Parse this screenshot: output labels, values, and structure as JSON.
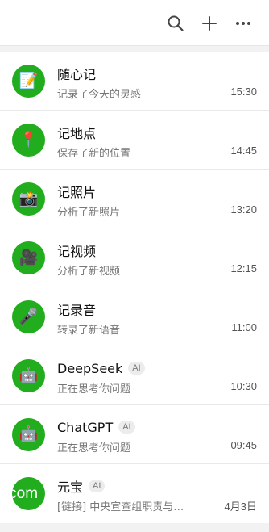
{
  "header": {
    "icons": [
      "search-icon",
      "plus-icon",
      "more-icon"
    ]
  },
  "chats": [
    {
      "name": "随心记",
      "preview": "记录了今天的灵感",
      "time": "15:30",
      "avatar_icon": "memo-icon",
      "avatar_glyph": "📝",
      "ai": false
    },
    {
      "name": "记地点",
      "preview": "保存了新的位置",
      "time": "14:45",
      "avatar_icon": "pin-icon",
      "avatar_glyph": "📍",
      "ai": false
    },
    {
      "name": "记照片",
      "preview": "分析了新照片",
      "time": "13:20",
      "avatar_icon": "camera-flash-icon",
      "avatar_glyph": "📸",
      "ai": false
    },
    {
      "name": "记视频",
      "preview": "分析了新视频",
      "time": "12:15",
      "avatar_icon": "video-camera-icon",
      "avatar_glyph": "🎥",
      "ai": false
    },
    {
      "name": "记录音",
      "preview": "转录了新语音",
      "time": "11:00",
      "avatar_icon": "microphone-icon",
      "avatar_glyph": "🎤",
      "ai": false
    },
    {
      "name": "DeepSeek",
      "preview": "正在思考你问题",
      "time": "10:30",
      "avatar_icon": "robot-icon",
      "avatar_glyph": "🤖",
      "ai": true,
      "badge": "AI"
    },
    {
      "name": "ChatGPT",
      "preview": "正在思考你问题",
      "time": "09:45",
      "avatar_icon": "robot-icon",
      "avatar_glyph": "🤖",
      "ai": true,
      "badge": "AI"
    },
    {
      "name": "元宝",
      "preview": "[链接] 中央宣查组职责与…",
      "time": "4月3日",
      "avatar_icon": "text-avatar",
      "avatar_text": ".com",
      "ai": true,
      "badge": "AI"
    }
  ],
  "colors": {
    "avatar_bg": "#22ad1e",
    "page_bg": "#f2f2f2"
  }
}
